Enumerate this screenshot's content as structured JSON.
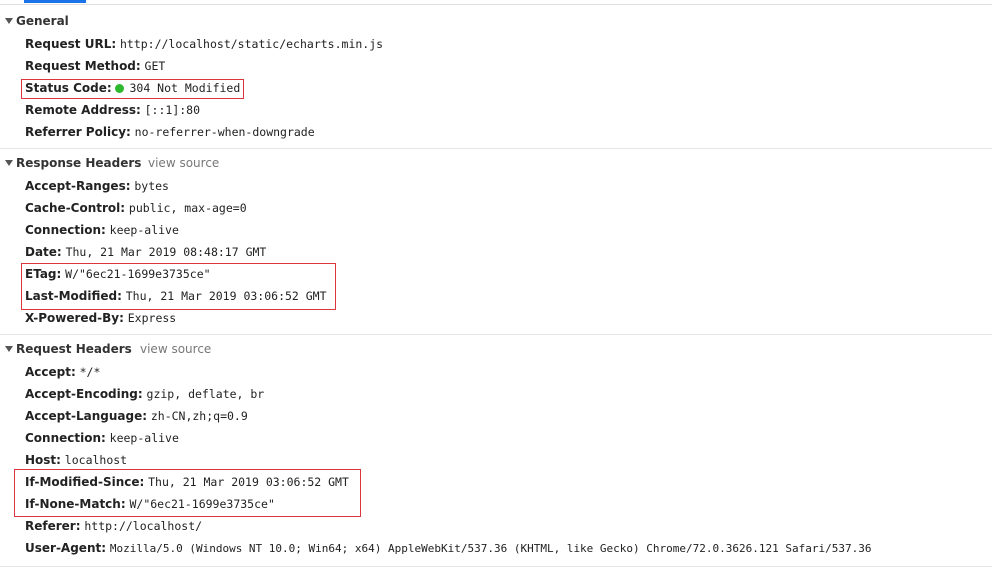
{
  "colors": {
    "accent": "#1a73e8",
    "highlight_box": "#d9363e",
    "status_ok": "#2eb82e"
  },
  "general": {
    "title": "General",
    "rows": [
      {
        "key": "Request URL:",
        "value": "http://localhost/static/echarts.min.js"
      },
      {
        "key": "Request Method:",
        "value": "GET"
      },
      {
        "key": "Status Code:",
        "value": "304 Not Modified"
      },
      {
        "key": "Remote Address:",
        "value": "[::1]:80"
      },
      {
        "key": "Referrer Policy:",
        "value": "no-referrer-when-downgrade"
      }
    ]
  },
  "response_headers": {
    "title": "Response Headers",
    "view_source": "view source",
    "rows": [
      {
        "key": "Accept-Ranges:",
        "value": "bytes"
      },
      {
        "key": "Cache-Control:",
        "value": "public, max-age=0"
      },
      {
        "key": "Connection:",
        "value": "keep-alive"
      },
      {
        "key": "Date:",
        "value": "Thu, 21 Mar 2019 08:48:17 GMT"
      },
      {
        "key": "ETag:",
        "value": "W/\"6ec21-1699e3735ce\""
      },
      {
        "key": "Last-Modified:",
        "value": "Thu, 21 Mar 2019 03:06:52 GMT"
      },
      {
        "key": "X-Powered-By:",
        "value": "Express"
      }
    ]
  },
  "request_headers": {
    "title": "Request Headers",
    "view_source": "view source",
    "rows": [
      {
        "key": "Accept:",
        "value": "*/*"
      },
      {
        "key": "Accept-Encoding:",
        "value": "gzip, deflate, br"
      },
      {
        "key": "Accept-Language:",
        "value": "zh-CN,zh;q=0.9"
      },
      {
        "key": "Connection:",
        "value": "keep-alive"
      },
      {
        "key": "Host:",
        "value": "localhost"
      },
      {
        "key": "If-Modified-Since:",
        "value": "Thu, 21 Mar 2019 03:06:52 GMT"
      },
      {
        "key": "If-None-Match:",
        "value": "W/\"6ec21-1699e3735ce\""
      },
      {
        "key": "Referer:",
        "value": "http://localhost/"
      },
      {
        "key": "User-Agent:",
        "value": "Mozilla/5.0 (Windows NT 10.0; Win64; x64) AppleWebKit/537.36 (KHTML, like Gecko) Chrome/72.0.3626.121 Safari/537.36"
      }
    ]
  }
}
